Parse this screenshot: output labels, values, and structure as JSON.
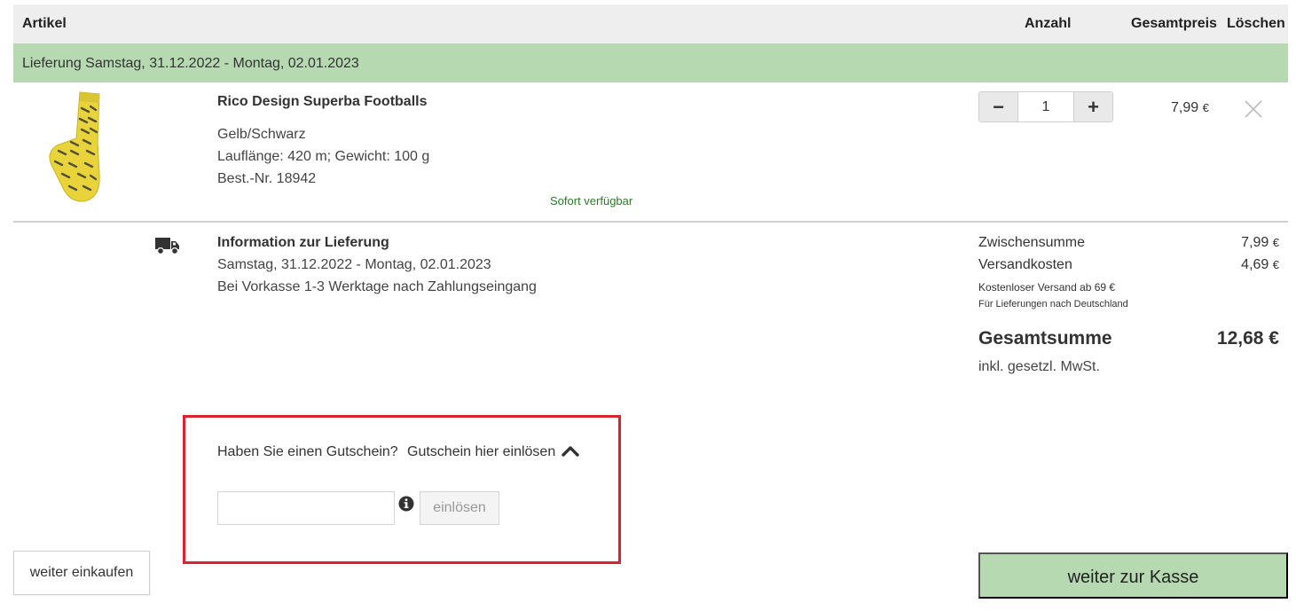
{
  "table_header": {
    "article": "Artikel",
    "quantity": "Anzahl",
    "total_price": "Gesamtpreis",
    "delete": "Löschen"
  },
  "delivery_banner": "Lieferung Samstag, 31.12.2022 - Montag, 02.01.2023",
  "product": {
    "image_icon": "sock-yarn-image",
    "name": "Rico Design Superba Footballs",
    "color": "Gelb/Schwarz",
    "details": "Lauflänge: 420 m; Gewicht: 100 g",
    "order_number": "Best.-Nr. 18942",
    "availability": "Sofort verfügbar",
    "quantity": "1",
    "minus_label": "−",
    "plus_label": "+",
    "price": "7,99",
    "price_currency": "€"
  },
  "delivery_info": {
    "icon": "truck-icon",
    "title": "Information zur Lieferung",
    "dates": "Samstag, 31.12.2022 - Montag, 02.01.2023",
    "note": "Bei Vorkasse 1-3 Werktage nach Zahlungseingang"
  },
  "summary": {
    "subtotal_label": "Zwischensumme",
    "subtotal_value": "7,99",
    "shipping_label": "Versandkosten",
    "shipping_value": "4,69",
    "currency": "€",
    "free_shipping_note": "Kostenloser Versand ab 69 €",
    "delivery_country_note": "Für Lieferungen nach Deutschland",
    "total_label": "Gesamtsumme",
    "total_value": "12,68 €",
    "vat_note": "inkl. gesetzl. MwSt."
  },
  "voucher": {
    "question": "Haben Sie einen Gutschein?",
    "toggle_label": "Gutschein hier einlösen",
    "input_value": "",
    "redeem_label": "einlösen"
  },
  "buttons": {
    "continue_shopping": "weiter einkaufen",
    "checkout": "weiter zur Kasse"
  },
  "colors": {
    "accent_green": "#b6d9b2",
    "availability_green": "#2f7a2a",
    "highlight_red": "#d9232d",
    "header_gray": "#eeeeee"
  }
}
